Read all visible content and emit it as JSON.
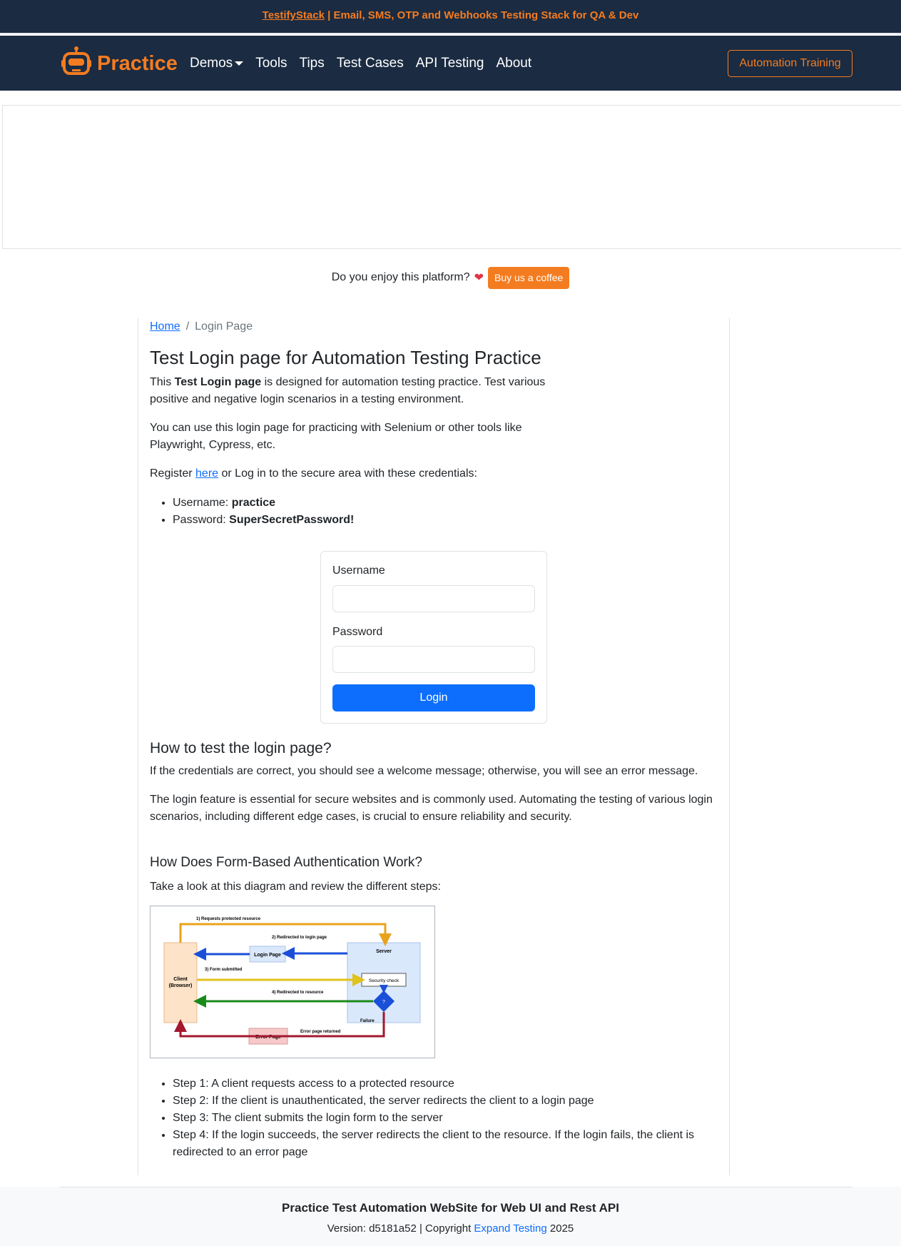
{
  "top_banner": {
    "brand": "TestifyStack",
    "text": " | Email, SMS, OTP and Webhooks Testing Stack for QA & Dev"
  },
  "nav": {
    "logo_text": "Practice",
    "logo_icon": "robot-icon",
    "items": [
      {
        "label": "Demos",
        "dropdown": true
      },
      {
        "label": "Tools"
      },
      {
        "label": "Tips"
      },
      {
        "label": "Test Cases"
      },
      {
        "label": "API Testing"
      },
      {
        "label": "About"
      }
    ],
    "cta": "Automation Training"
  },
  "support": {
    "text": "Do you enjoy this platform?",
    "heart": "❤",
    "button": "Buy us a coffee"
  },
  "breadcrumb": {
    "home": "Home",
    "sep": "/",
    "current": "Login Page"
  },
  "content": {
    "title": "Test Login page for Automation Testing Practice",
    "intro_pre": "This ",
    "intro_bold": "Test Login page",
    "intro_post": " is designed for automation testing practice. Test various positive and negative login scenarios in a testing environment.",
    "tools_para": "You can use this login page for practicing with Selenium or other tools like Playwright, Cypress, etc.",
    "register_pre": "Register ",
    "register_link": "here",
    "register_post": " or Log in to the secure area with these credentials:",
    "username_label": "Username: ",
    "username_value": "practice",
    "password_label": "Password: ",
    "password_value": "SuperSecretPassword!"
  },
  "login_form": {
    "username_label": "Username",
    "username_value": "",
    "password_label": "Password",
    "password_value": "",
    "submit": "Login"
  },
  "how_to": {
    "heading": "How to test the login page?",
    "p1": "If the credentials are correct, you should see a welcome message; otherwise, you will see an error message.",
    "p2": "The login feature is essential for secure websites and is commonly used. Automating the testing of various login scenarios, including different edge cases, is crucial to ensure reliability and security."
  },
  "form_auth": {
    "heading": "How Does Form-Based Authentication Work?",
    "intro": "Take a look at this diagram and review the different steps:",
    "diagram": {
      "step1": "1) Requests protected resource",
      "step2": "2) Redirected to login page",
      "step3": "3) Form submitted",
      "step4": "4) Redirected to resource",
      "login_page": "Login Page",
      "server": "Server",
      "client": "Client",
      "client_sub": "(Browser)",
      "security_check": "Security check",
      "decision": "?",
      "failure": "Failure",
      "error_returned": "Error page returned",
      "error_page": "Error Page",
      "colors": {
        "orange": "#e8a31c",
        "blue": "#1a4fd8",
        "yellow": "#e0c21a",
        "green": "#1a8a1a",
        "red": "#a3182e"
      }
    },
    "steps": [
      "Step 1: A client requests access to a protected resource",
      "Step 2: If the client is unauthenticated, the server redirects the client to a login page",
      "Step 3: The client submits the login form to the server",
      "Step 4: If the login succeeds, the server redirects the client to the resource. If the login fails, the client is redirected to an error page"
    ]
  },
  "footer": {
    "title": "Practice Test Automation WebSite for Web UI and Rest API",
    "version": "Version: d5181a52 | Copyright ",
    "company": "Expand Testing",
    "year": " 2025"
  },
  "colors": {
    "navy": "#1a2b42",
    "orange": "#f47c20",
    "primary": "#0d6efd"
  }
}
